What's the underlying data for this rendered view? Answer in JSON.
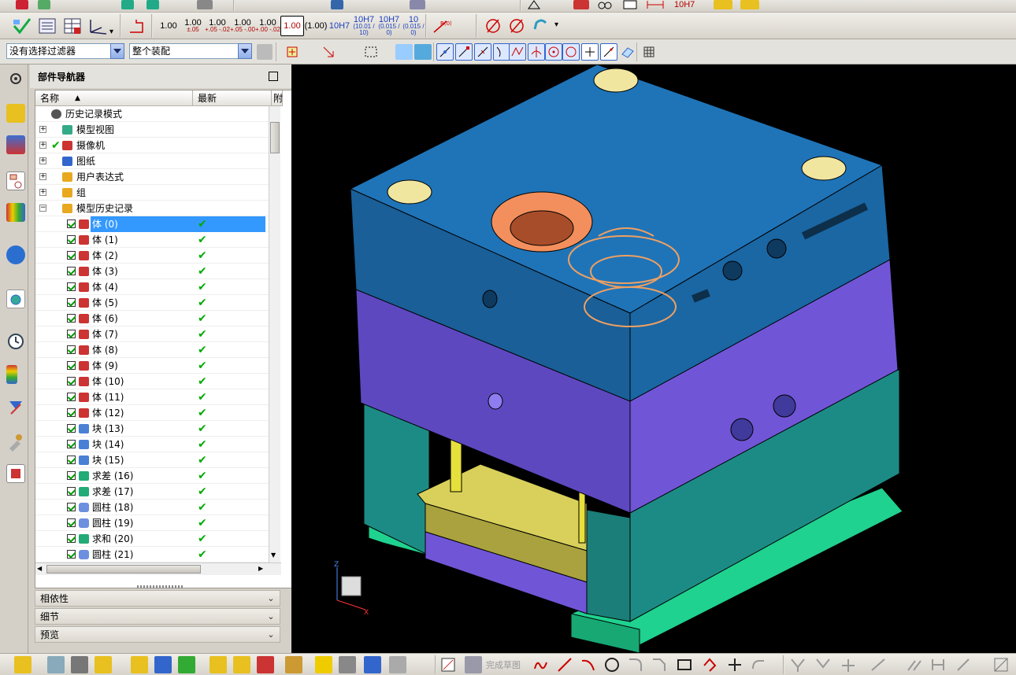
{
  "toolbar_top": {
    "tolerance_label": "10H7"
  },
  "toolbar_dims": [
    {
      "main": "1.00",
      "sub": ""
    },
    {
      "main": "1.00",
      "sub": "±.05"
    },
    {
      "main": "1.00",
      "sub": "+.05 -.02"
    },
    {
      "main": "1.00",
      "sub": "+.05 -.00"
    },
    {
      "main": "1.00",
      "sub": "+.00 -.02"
    },
    {
      "main": "1.00",
      "sub": ""
    },
    {
      "main": "(1.00)",
      "sub": ""
    },
    {
      "main": "10H7",
      "sub": ""
    },
    {
      "main": "10H7",
      "sub": "(10.01 / 10)"
    },
    {
      "main": "10H7",
      "sub": "(0.015 / 0)"
    },
    {
      "main": "10",
      "sub": "(0.015 / 0)"
    }
  ],
  "filter": {
    "selection_filter": "没有选择过滤器",
    "assembly_scope": "整个装配"
  },
  "navigator": {
    "title": "部件导航器",
    "col_name": "名称",
    "col_latest": "最新",
    "col_third": "附",
    "top_items": [
      {
        "label": "历史记录模式",
        "icon": "clock-icon"
      },
      {
        "label": "模型视图",
        "icon": "model-view-icon"
      },
      {
        "label": "摄像机",
        "icon": "camera-icon"
      },
      {
        "label": "图纸",
        "icon": "drawing-icon"
      },
      {
        "label": "用户表达式",
        "icon": "folder-icon"
      },
      {
        "label": "组",
        "icon": "folder-icon"
      },
      {
        "label": "模型历史记录",
        "icon": "folder-icon"
      }
    ],
    "features": [
      {
        "label": "体 (0)",
        "icon": "body-icon",
        "selected": true
      },
      {
        "label": "体 (1)",
        "icon": "body-icon"
      },
      {
        "label": "体 (2)",
        "icon": "body-icon"
      },
      {
        "label": "体 (3)",
        "icon": "body-icon"
      },
      {
        "label": "体 (4)",
        "icon": "body-icon"
      },
      {
        "label": "体 (5)",
        "icon": "body-icon"
      },
      {
        "label": "体 (6)",
        "icon": "body-icon"
      },
      {
        "label": "体 (7)",
        "icon": "body-icon"
      },
      {
        "label": "体 (8)",
        "icon": "body-icon"
      },
      {
        "label": "体 (9)",
        "icon": "body-icon"
      },
      {
        "label": "体 (10)",
        "icon": "body-icon"
      },
      {
        "label": "体 (11)",
        "icon": "body-icon"
      },
      {
        "label": "体 (12)",
        "icon": "body-icon"
      },
      {
        "label": "块 (13)",
        "icon": "block-icon"
      },
      {
        "label": "块 (14)",
        "icon": "block-icon"
      },
      {
        "label": "块 (15)",
        "icon": "block-icon"
      },
      {
        "label": "求差 (16)",
        "icon": "subtract-icon"
      },
      {
        "label": "求差 (17)",
        "icon": "subtract-icon"
      },
      {
        "label": "圆柱 (18)",
        "icon": "cylinder-icon"
      },
      {
        "label": "圆柱 (19)",
        "icon": "cylinder-icon"
      },
      {
        "label": "求和 (20)",
        "icon": "unite-icon"
      },
      {
        "label": "圆柱 (21)",
        "icon": "cylinder-icon"
      }
    ],
    "panels": [
      "相依性",
      "细节",
      "预览"
    ]
  },
  "bottom_toolbar": {
    "finish_sketch": "完成草图"
  },
  "colors": {
    "top_plate": "#1f74b8",
    "a_plate": "#7056d6",
    "b_plate": "#1d8b85",
    "base": "#1fd28f",
    "ejector": "#d8d05a",
    "sketch": "#f0a060",
    "background": "#000000"
  }
}
